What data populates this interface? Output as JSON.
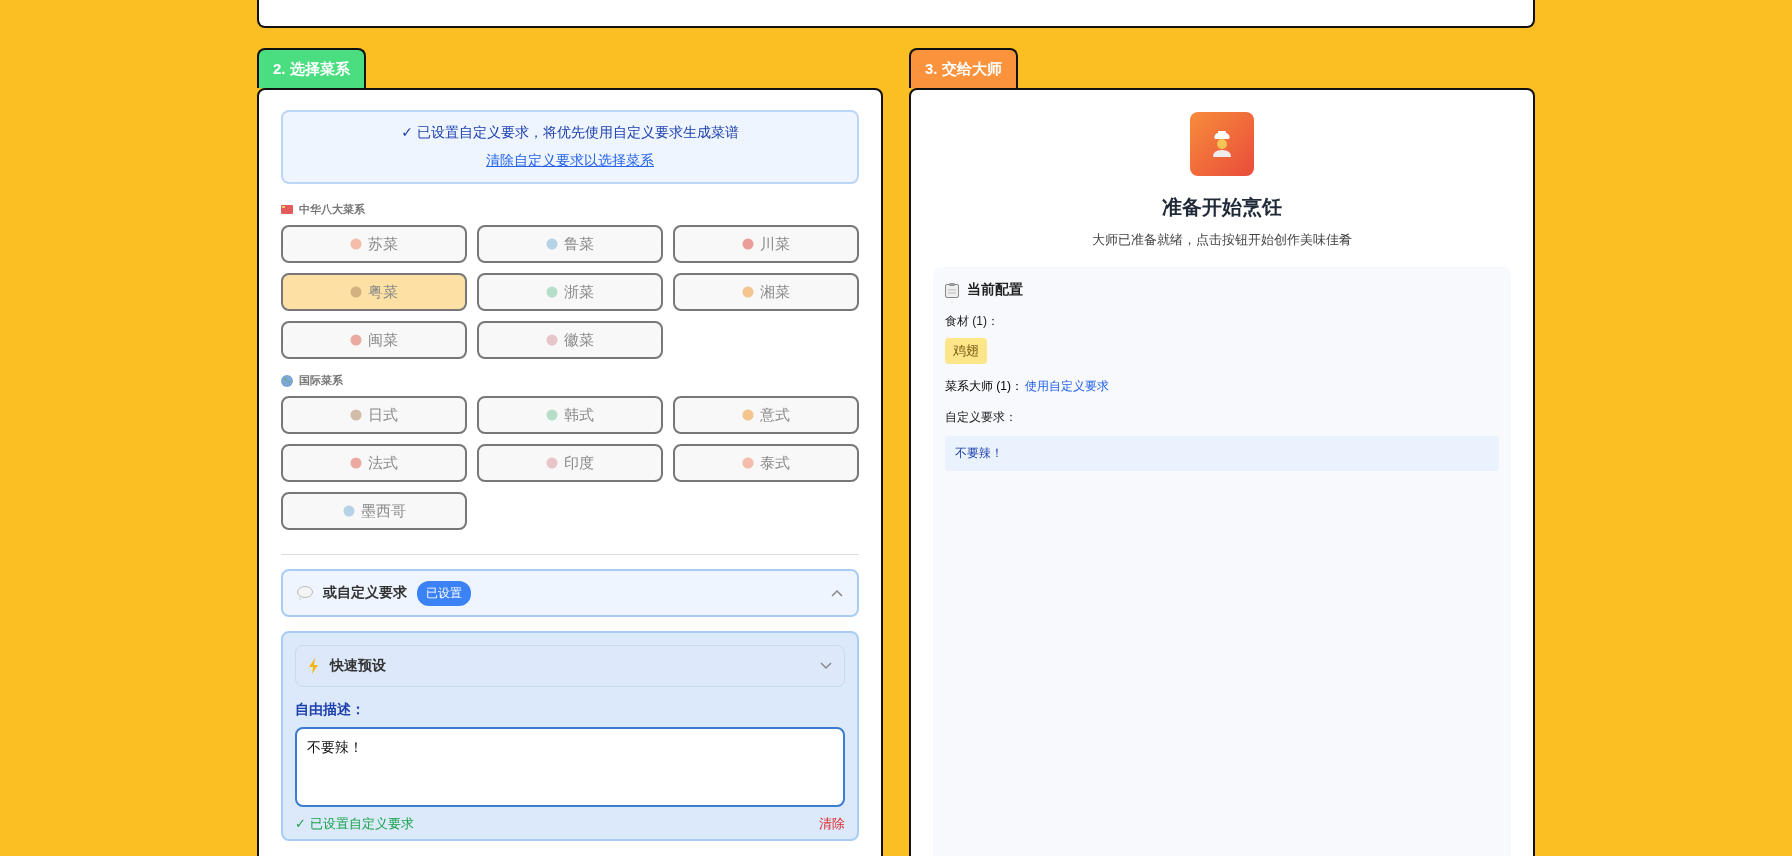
{
  "cuisine_panel": {
    "tab": "2. 选择菜系",
    "notice": {
      "message": "✓ 已设置自定义要求，将优先使用自定义要求生成菜谱",
      "link": "清除自定义要求以选择菜系"
    },
    "groups": [
      {
        "kind": "chinese",
        "title": "中华八大菜系",
        "items": [
          {
            "label": "苏菜",
            "selected": false,
            "disabled": true
          },
          {
            "label": "鲁菜",
            "selected": false,
            "disabled": true
          },
          {
            "label": "川菜",
            "selected": false,
            "disabled": true
          },
          {
            "label": "粤菜",
            "selected": true,
            "disabled": true
          },
          {
            "label": "浙菜",
            "selected": false,
            "disabled": true
          },
          {
            "label": "湘菜",
            "selected": false,
            "disabled": true
          },
          {
            "label": "闽菜",
            "selected": false,
            "disabled": true
          },
          {
            "label": "徽菜",
            "selected": false,
            "disabled": true
          }
        ]
      },
      {
        "kind": "international",
        "title": "国际菜系",
        "items": [
          {
            "label": "日式",
            "selected": false,
            "disabled": true
          },
          {
            "label": "韩式",
            "selected": false,
            "disabled": true
          },
          {
            "label": "意式",
            "selected": false,
            "disabled": true
          },
          {
            "label": "法式",
            "selected": false,
            "disabled": true
          },
          {
            "label": "印度",
            "selected": false,
            "disabled": true
          },
          {
            "label": "泰式",
            "selected": false,
            "disabled": true
          },
          {
            "label": "墨西哥",
            "selected": false,
            "disabled": true
          }
        ]
      }
    ],
    "custom": {
      "title": "或自定义要求",
      "badge": "已设置",
      "expanded": true,
      "presets": {
        "label": "快速预设",
        "expanded": false
      },
      "description_label": "自由描述：",
      "value": "不要辣！",
      "status": "✓ 已设置自定义要求",
      "clear": "清除"
    }
  },
  "master_panel": {
    "tab": "3. 交给大师",
    "title": "准备开始烹饪",
    "subtitle": "大师已准备就绪，点击按钮开始创作美味佳肴",
    "config": {
      "title": "当前配置",
      "ingredients_label": "食材 (1)：",
      "ingredients": [
        "鸡翅"
      ],
      "master_label": "菜系大师 (1)：",
      "master_value": "使用自定义要求",
      "custom_label": "自定义要求：",
      "custom_value": "不要辣！"
    }
  }
}
